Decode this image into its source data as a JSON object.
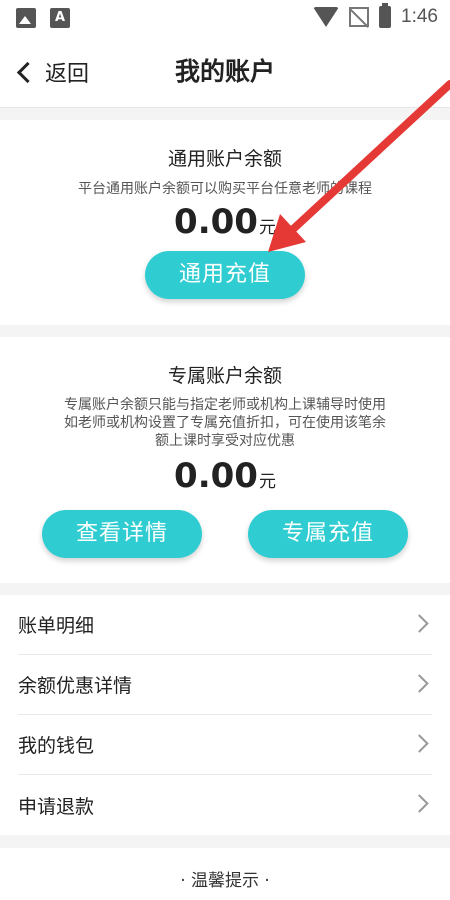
{
  "status_bar": {
    "time": "1:46",
    "icons": [
      "image-icon",
      "font-icon",
      "wifi-icon",
      "no-signal-icon",
      "battery-charging-icon"
    ]
  },
  "header": {
    "back_label": "返回",
    "title": "我的账户"
  },
  "general_account": {
    "title": "通用账户余额",
    "description": "平台通用账户余额可以购买平台任意老师的课程",
    "amount": "0.00",
    "unit": "元",
    "recharge_label": "通用充值"
  },
  "exclusive_account": {
    "title": "专属账户余额",
    "description_lines": [
      "专属账户余额只能与指定老师或机构上课辅导时使用",
      "如老师或机构设置了专属充值折扣，可在使用该笔余",
      "额上课时享受对应优惠"
    ],
    "amount": "0.00",
    "unit": "元",
    "details_label": "查看详情",
    "recharge_label": "专属充值"
  },
  "menu": {
    "items": [
      {
        "label": "账单明细"
      },
      {
        "label": "余额优惠详情"
      },
      {
        "label": "我的钱包"
      },
      {
        "label": "申请退款"
      }
    ]
  },
  "footer": {
    "tips_label": "· 温馨提示 ·"
  },
  "colors": {
    "accent": "#2fcdd2",
    "annotation_arrow": "#e53935",
    "background": "#f4f4f4"
  }
}
